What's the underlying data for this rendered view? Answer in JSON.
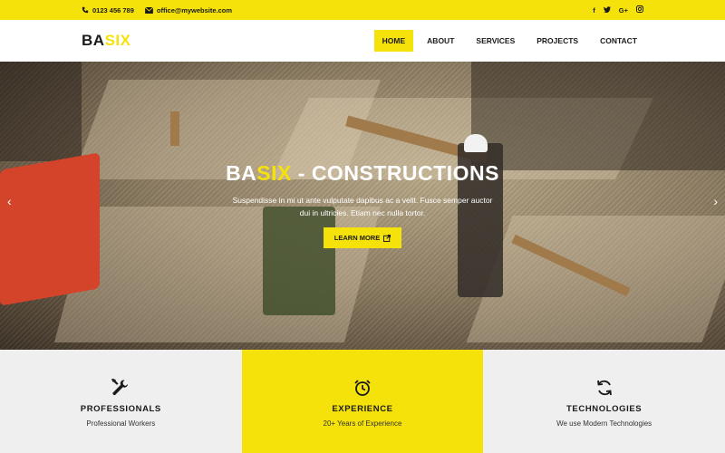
{
  "topbar": {
    "phone": "0123 456 789",
    "email": "office@mywebsite.com",
    "social": [
      "f",
      "t",
      "G+",
      "ig"
    ]
  },
  "navbar": {
    "logo_part1": "BA",
    "logo_part2": "SIX",
    "items": [
      {
        "label": "HOME",
        "active": true
      },
      {
        "label": "ABOUT",
        "active": false
      },
      {
        "label": "SERVICES",
        "active": false
      },
      {
        "label": "PROJECTS",
        "active": false
      },
      {
        "label": "CONTACT",
        "active": false
      }
    ]
  },
  "hero": {
    "title_part1": "BA",
    "title_part2": "SIX",
    "title_part3": " - CONSTRUCTIONS",
    "text": "Suspendisse in mi ut ante vulputate dapibus ac a velit. Fusce semper auctor dui in ultricies. Etiam nec nulla tortor.",
    "button_label": "LEARN MORE",
    "prev_arrow": "‹",
    "next_arrow": "›"
  },
  "features": [
    {
      "title": "PROFESSIONALS",
      "subtitle": "Professional Workers",
      "icon": "wrench-icon"
    },
    {
      "title": "EXPERIENCE",
      "subtitle": "20+ Years of Experience",
      "icon": "alarm-clock-icon"
    },
    {
      "title": "TECHNOLOGIES",
      "subtitle": "We use Modern Technologies",
      "icon": "refresh-icon"
    }
  ],
  "colors": {
    "accent": "#f5e20a",
    "text": "#1a1a1a",
    "feature_bg": "#efefef"
  }
}
